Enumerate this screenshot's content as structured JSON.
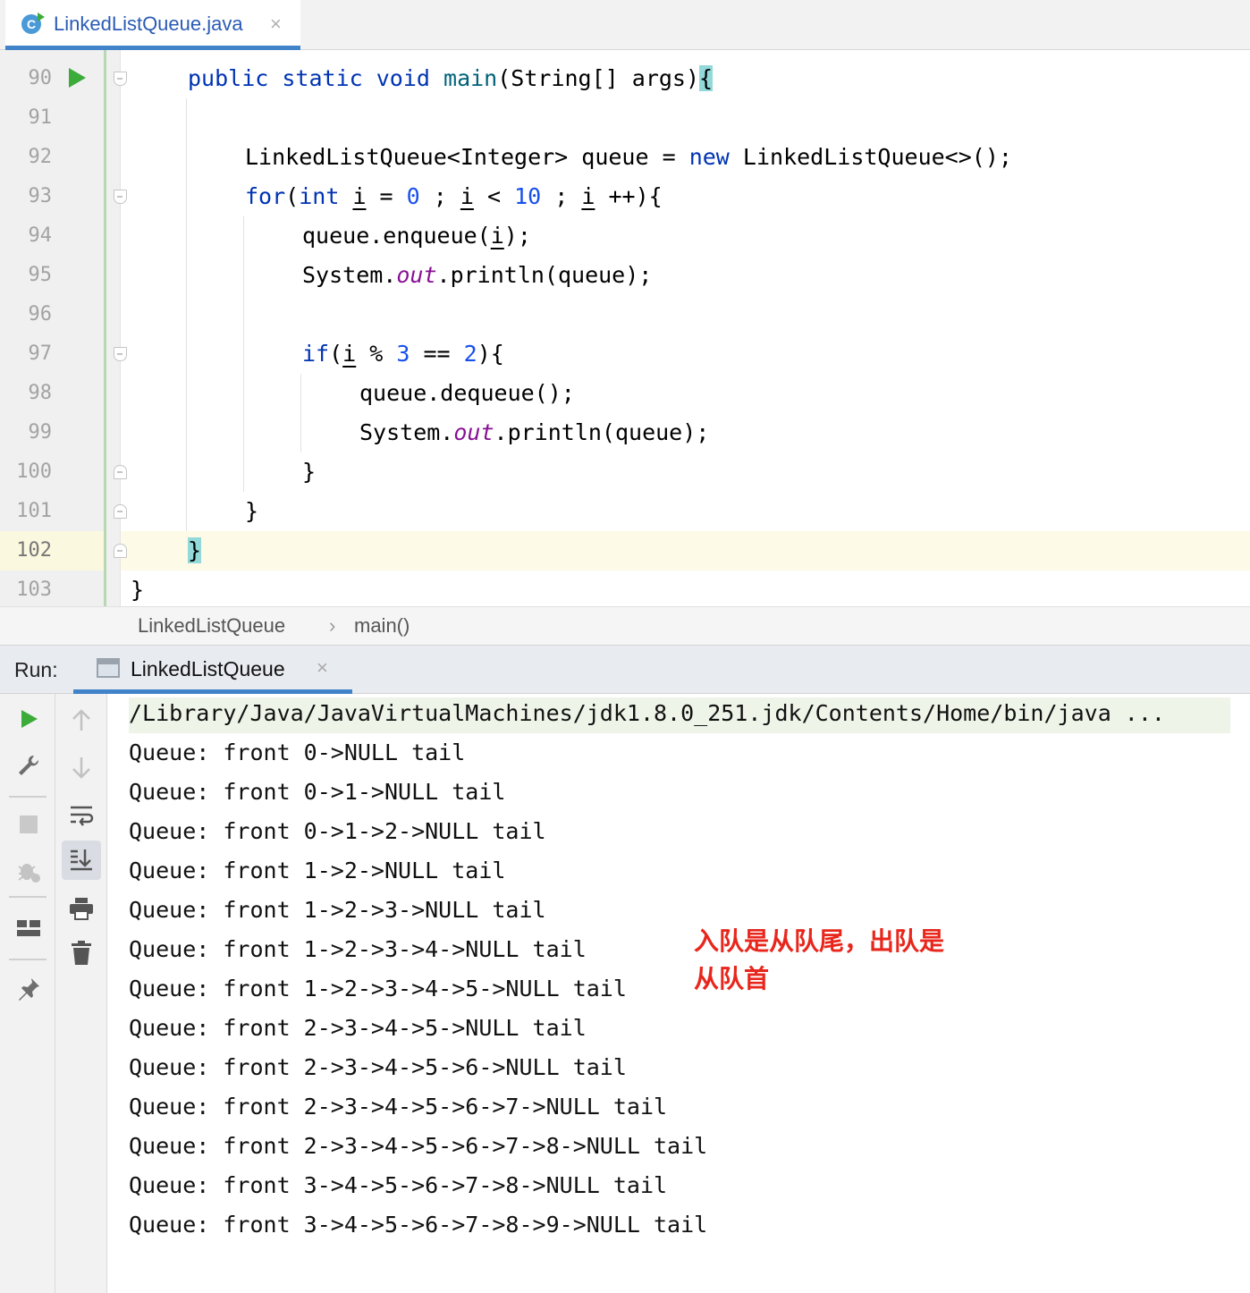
{
  "editor_tab": {
    "title": "LinkedListQueue.java",
    "icon": "java-class-icon",
    "close": "×"
  },
  "editor": {
    "line_numbers": [
      "90",
      "91",
      "92",
      "93",
      "94",
      "95",
      "96",
      "97",
      "98",
      "99",
      "100",
      "101",
      "102",
      "103"
    ],
    "current_line": "102",
    "code_tokens": {
      "l90": [
        "public",
        "static",
        "void",
        "main",
        "(String[] args)",
        "{"
      ],
      "l92": [
        "LinkedListQueue<Integer> queue = ",
        "new",
        " LinkedListQueue<>();"
      ],
      "l93": [
        "for",
        "(",
        "int",
        " ",
        "i",
        " = ",
        "0",
        " ; ",
        "i",
        " < ",
        "10",
        " ; ",
        "i",
        " ++){"
      ],
      "l94": [
        "queue.enqueue(",
        "i",
        ");"
      ],
      "l95": [
        "System.",
        "out",
        ".println(queue);"
      ],
      "l97": [
        "if",
        "(",
        "i",
        " % ",
        "3",
        " == ",
        "2",
        "){"
      ],
      "l98": [
        "queue.dequeue();"
      ],
      "l99": [
        "System.",
        "out",
        ".println(queue);"
      ],
      "l100": [
        "}"
      ],
      "l101": [
        "}"
      ],
      "l102": [
        "}"
      ],
      "l103": [
        "}"
      ]
    }
  },
  "breadcrumb": {
    "items": [
      "LinkedListQueue",
      "main()"
    ],
    "separator": "›"
  },
  "run_panel": {
    "label": "Run:",
    "tab_title": "LinkedListQueue",
    "tab_close": "×",
    "toolbar_left": [
      "run-icon",
      "wrench-icon",
      "stop-icon",
      "debug-icon",
      "layout-icon",
      "pin-icon"
    ],
    "toolbar_right": [
      "up-arrow-icon",
      "down-arrow-icon",
      "soft-wrap-icon",
      "scroll-to-end-icon",
      "print-icon",
      "trash-icon"
    ],
    "command": "/Library/Java/JavaVirtualMachines/jdk1.8.0_251.jdk/Contents/Home/bin/java ...",
    "output": [
      "Queue: front 0->NULL tail",
      "Queue: front 0->1->NULL tail",
      "Queue: front 0->1->2->NULL tail",
      "Queue: front 1->2->NULL tail",
      "Queue: front 1->2->3->NULL tail",
      "Queue: front 1->2->3->4->NULL tail",
      "Queue: front 1->2->3->4->5->NULL tail",
      "Queue: front 2->3->4->5->NULL tail",
      "Queue: front 2->3->4->5->6->NULL tail",
      "Queue: front 2->3->4->5->6->7->NULL tail",
      "Queue: front 2->3->4->5->6->7->8->NULL tail",
      "Queue: front 3->4->5->6->7->8->NULL tail",
      "Queue: front 3->4->5->6->7->8->9->NULL tail"
    ]
  },
  "annotation": {
    "line1": "入队是从队尾，出队是",
    "line2": "从队首",
    "color": "#e8261c"
  },
  "colors": {
    "keyword": "#0033b3",
    "number": "#1750eb",
    "static_field": "#871094",
    "method_decl": "#00627a",
    "run_green": "#3bab3a",
    "tab_accent": "#4083c9"
  }
}
